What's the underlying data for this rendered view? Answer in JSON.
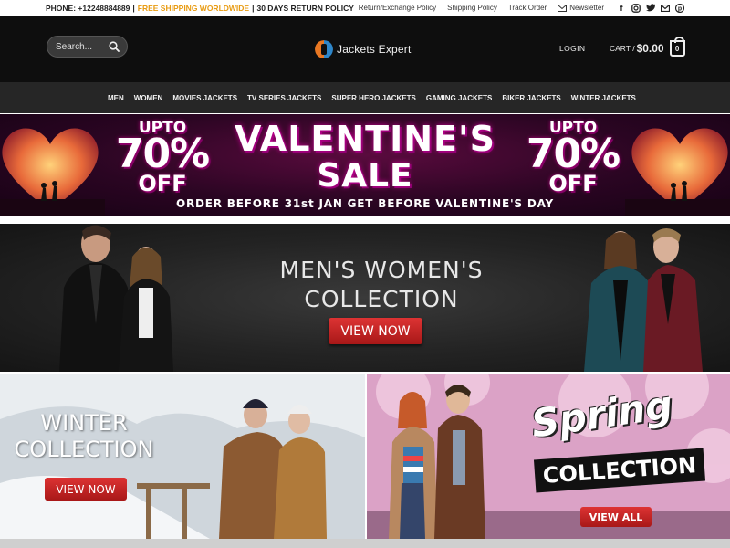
{
  "topbar": {
    "phone": "PHONE: +12248884889",
    "free_shipping": "FREE SHIPPING WORLDWIDE",
    "returns": "30 DAYS RETURN POLICY",
    "separator": "|",
    "links": [
      "Return/Exchange Policy",
      "Shipping Policy",
      "Track Order"
    ],
    "newsletter": "Newsletter",
    "social_icons": [
      "facebook-icon",
      "instagram-icon",
      "twitter-icon",
      "email-icon",
      "pinterest-icon"
    ]
  },
  "header": {
    "search_placeholder": "Search...",
    "logo_text": "Jackets Expert",
    "login": "LOGIN",
    "cart_label": "CART /",
    "cart_amount": "$0.00",
    "cart_count": "0"
  },
  "nav": {
    "items": [
      "MEN",
      "WOMEN",
      "MOVIES JACKETS",
      "TV SERIES JACKETS",
      "SUPER HERO JACKETS",
      "GAMING JACKETS",
      "BIKER JACKETS",
      "WINTER JACKETS"
    ]
  },
  "valentine": {
    "upto": "UPTO",
    "percent": "70%",
    "off": "OFF",
    "title_line1": "VALENTINE'S",
    "title_line2": "SALE",
    "subtitle": "ORDER BEFORE 31st JAN GET BEFORE VALENTINE'S DAY"
  },
  "mens_womens": {
    "title_line1": "MEN'S WOMEN'S",
    "title_line2": "COLLECTION",
    "button": "VIEW NOW"
  },
  "winter": {
    "title_line1": "WINTER",
    "title_line2": "COLLECTION",
    "button": "VIEW NOW"
  },
  "spring": {
    "title": "Spring",
    "subtitle": "COLLECTION",
    "button": "VIEW ALL"
  },
  "colors": {
    "header_bg": "#0e0e0e",
    "nav_bg": "#262626",
    "accent_orange": "#e89b12",
    "button_red": "#c62525"
  }
}
